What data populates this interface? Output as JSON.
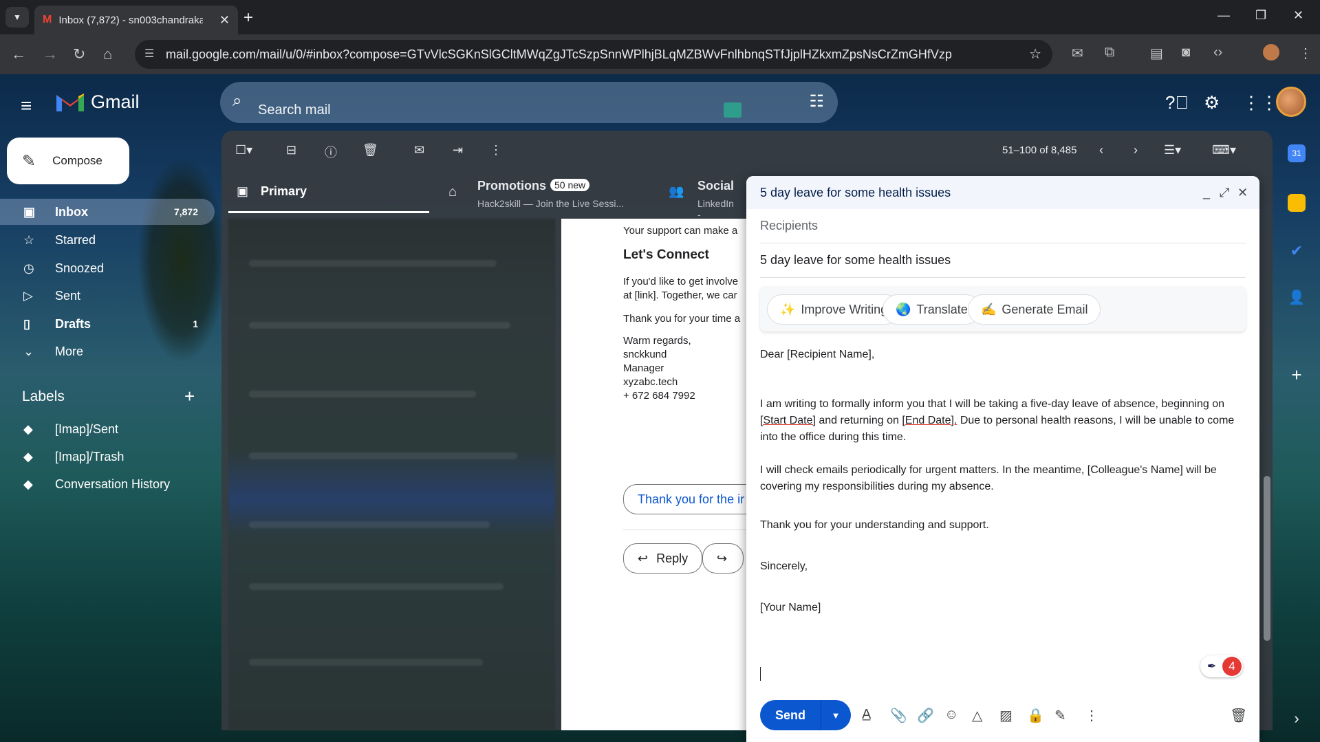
{
  "browser": {
    "tab_title": "Inbox (7,872) - sn003chandraka",
    "url": "mail.google.com/mail/u/0/#inbox?compose=GTvVlcSGKnSlGCltMWqZgJTcSzpSnnWPlhjBLqMZBWvFnlhbnqSTfJjplHZkxmZpsNsCrZmGHfVzp"
  },
  "header": {
    "app_name": "Gmail",
    "search_placeholder": "Search mail"
  },
  "sidebar": {
    "compose_label": "Compose",
    "items": [
      {
        "label": "Inbox",
        "count": "7,872",
        "icon": "inbox-icon"
      },
      {
        "label": "Starred",
        "count": "",
        "icon": "star-icon"
      },
      {
        "label": "Snoozed",
        "count": "",
        "icon": "clock-icon"
      },
      {
        "label": "Sent",
        "count": "",
        "icon": "send-icon"
      },
      {
        "label": "Drafts",
        "count": "1",
        "icon": "draft-icon"
      },
      {
        "label": "More",
        "count": "",
        "icon": "chevron-down-icon"
      }
    ],
    "labels_heading": "Labels",
    "labels": [
      "[Imap]/Sent",
      "[Imap]/Trash",
      "Conversation History"
    ]
  },
  "toolbar": {
    "pager": "51–100 of 8,485"
  },
  "tabs": {
    "primary": "Primary",
    "promotions": "Promotions",
    "promotions_badge": "50 new",
    "promotions_sub": "Hack2skill — Join the Live Sessi...",
    "social": "Social",
    "social_sub": "LinkedIn -"
  },
  "reading": {
    "line1": "Your support can make a",
    "heading": "Let's Connect",
    "line2": "If you'd like to get involve",
    "line3": "at [link]. Together, we car",
    "line4": "Thank you for your time a",
    "sig1": "Warm regards,",
    "sig2": "snckkund",
    "sig3": "Manager",
    "sig4": "xyzabc.tech",
    "sig5": "+ 672 684 7992",
    "smart_reply": "Thank you for the ir",
    "reply": "Reply"
  },
  "compose": {
    "title": "5 day leave for some health issues",
    "recipients_placeholder": "Recipients",
    "subject": "5 day leave for some health issues",
    "ai_buttons": [
      {
        "emoji": "✨",
        "label": "Improve Writing"
      },
      {
        "emoji": "🌏",
        "label": "Translate"
      },
      {
        "emoji": "✍️",
        "label": "Generate Email"
      }
    ],
    "greeting": "Dear [Recipient Name],",
    "para1_a": "I am writing to formally inform you that I will be taking a five-day leave of absence, beginning on",
    "para1_start": "[Start Date]",
    "para1_b": " and returning on ",
    "para1_end": "[End Date].",
    "para1_c": " Due to personal health reasons, I will be unable to come",
    "para1_d": "into the office during this time.",
    "para2_a": "I will check emails periodically for urgent matters. In the meantime, [Colleague's Name] will be",
    "para2_b": "covering my responsibilities during my absence.",
    "para3": "Thank you for your understanding and support.",
    "closing": "Sincerely,",
    "name": "[Your Name]",
    "grammar_count": "4",
    "send_label": "Send"
  }
}
